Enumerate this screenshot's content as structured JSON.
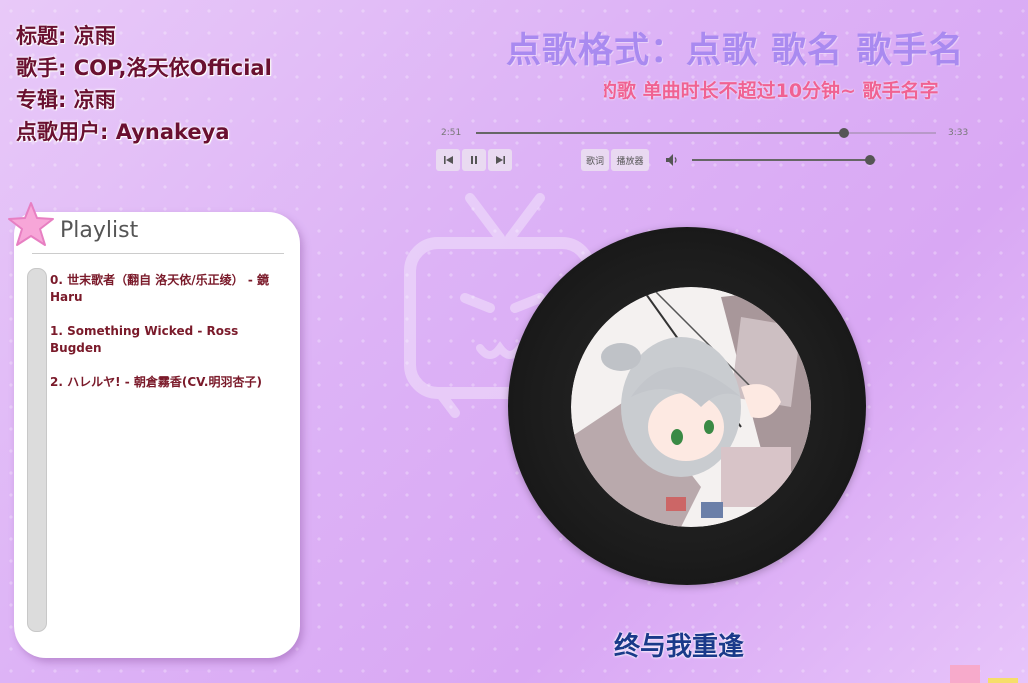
{
  "song": {
    "title_row": "标题: 凉雨",
    "artist_row": "歌手: COP,洛天依Official",
    "album_row": "专辑: 凉雨",
    "requester_row": "点歌用户: Aynakeya"
  },
  "headline": {
    "format": "点歌格式：点歌 歌名 歌手名",
    "marquee": "的歌   单曲时长不超过10分钟~  歌手名字"
  },
  "player": {
    "current_time": "2:51",
    "total_time": "3:33",
    "progress": 0.8,
    "volume": 0.97,
    "lyrics_button": "歌词",
    "player_button": "播放器"
  },
  "playlist": {
    "title": "Playlist",
    "items": [
      "0. 世末歌者（翻自 洛天依/乐正绫） - 鏡Haru",
      "1. Something Wicked - Ross Bugden",
      "2. ハレルヤ! - 朝倉霧香(CV.明羽杏子)"
    ]
  },
  "lyric": "终与我重逢",
  "colors": {
    "info_text": "#6a1030",
    "headline": "#a98af0",
    "marquee": "#f06292",
    "lyric": "#1a3a8a"
  }
}
